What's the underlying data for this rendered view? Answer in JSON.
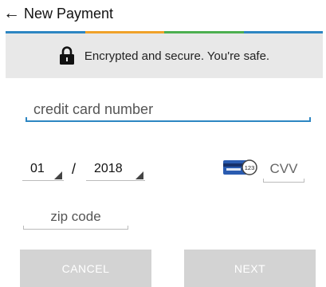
{
  "header": {
    "back_icon": "left-arrow-icon",
    "back_glyph": "←",
    "title": "New Payment"
  },
  "stripe_colors": [
    "#2d86c2",
    "#f0a22a",
    "#4caf50",
    "#2d86c2"
  ],
  "banner": {
    "icon": "lock-icon",
    "text": "Encrypted and secure. You're safe."
  },
  "form": {
    "card_number_placeholder": "credit card number",
    "expiry_month": "01",
    "expiry_separator": "/",
    "expiry_year": "2018",
    "card_icon": "credit-card-cvv-icon",
    "card_icon_text": "123",
    "cvv_placeholder": "CVV",
    "zip_placeholder": "zip code"
  },
  "buttons": {
    "cancel": "CANCEL",
    "next": "NEXT"
  },
  "colors": {
    "accent": "#2d86c2",
    "banner_bg": "#e8e8e8",
    "button_disabled": "#d3d3d3"
  }
}
